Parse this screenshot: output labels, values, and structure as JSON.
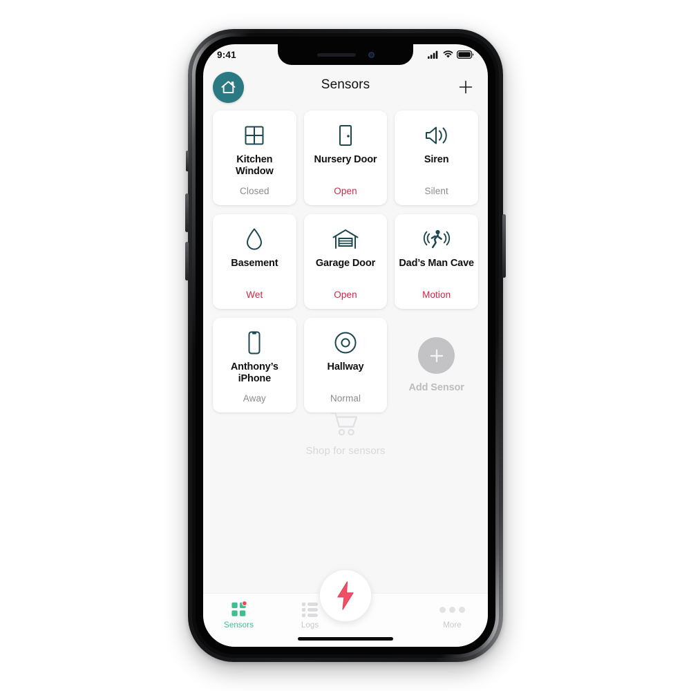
{
  "status_bar": {
    "time": "9:41",
    "icons": [
      "cellular-signal-icon",
      "wifi-icon",
      "battery-icon"
    ]
  },
  "nav": {
    "title": "Sensors",
    "home_icon": "home-icon",
    "add_icon": "plus-icon"
  },
  "colors": {
    "teal": "#2b7983",
    "alert_red": "#cf2744",
    "muted_gray": "#8b8b8d",
    "tab_green": "#3fbf8f",
    "fab_red": "#f14f63",
    "placeholder_gray": "#d8d8da"
  },
  "sensors": [
    {
      "name": "Kitchen Window",
      "status": "Closed",
      "alert": false,
      "icon": "window-icon"
    },
    {
      "name": "Nursery Door",
      "status": "Open",
      "alert": true,
      "icon": "door-icon"
    },
    {
      "name": "Siren",
      "status": "Silent",
      "alert": false,
      "icon": "speaker-icon"
    },
    {
      "name": "Basement",
      "status": "Wet",
      "alert": true,
      "icon": "water-drop-icon"
    },
    {
      "name": "Garage Door",
      "status": "Open",
      "alert": true,
      "icon": "garage-door-icon"
    },
    {
      "name": "Dad’s Man Cave",
      "status": "Motion",
      "alert": true,
      "icon": "motion-sensor-icon"
    },
    {
      "name": "Anthony’s iPhone",
      "status": "Away",
      "alert": false,
      "icon": "phone-icon"
    },
    {
      "name": "Hallway",
      "status": "Normal",
      "alert": false,
      "icon": "smoke-detector-icon"
    }
  ],
  "add_sensor": {
    "label": "Add Sensor",
    "icon": "plus-circle-icon"
  },
  "shop": {
    "label": "Shop for sensors",
    "icon": "shopping-cart-icon"
  },
  "tabs": [
    {
      "label": "Sensors",
      "icon": "sensors-grid-icon",
      "active": true,
      "badge": true
    },
    {
      "label": "Logs",
      "icon": "logs-list-icon",
      "active": false,
      "badge": false
    },
    {
      "label": "More",
      "icon": "more-dots-icon",
      "active": false,
      "badge": false
    }
  ],
  "fab": {
    "icon": "lightning-bolt-icon"
  }
}
